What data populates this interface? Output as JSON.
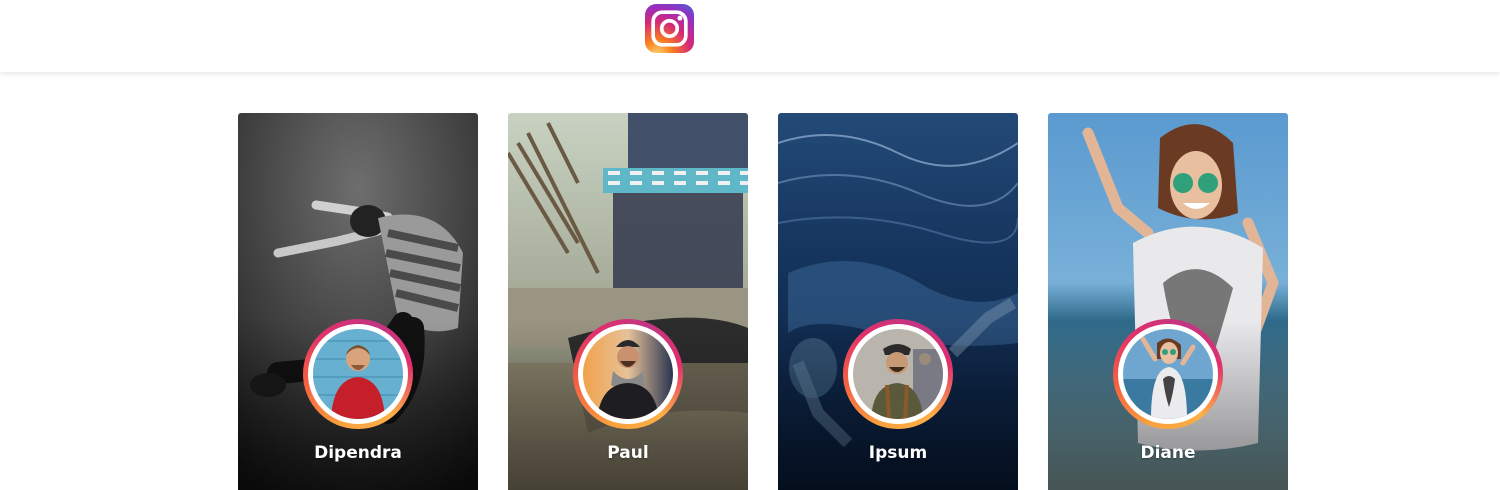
{
  "header": {
    "logo_icon": "instagram-icon",
    "logo_colors": [
      "#feda75",
      "#fa7e1e",
      "#d62976",
      "#962fbf",
      "#4f5bd5"
    ]
  },
  "stories": [
    {
      "name": "Dipendra",
      "avatar_icon": "profile-photo",
      "background": "grayscale-dancer-photo"
    },
    {
      "name": "Paul",
      "avatar_icon": "profile-photo",
      "background": "sunglasses-on-sand-photo"
    },
    {
      "name": "Ipsum",
      "avatar_icon": "profile-photo",
      "background": "underwater-swimmers-photo"
    },
    {
      "name": "Diane",
      "avatar_icon": "profile-photo",
      "background": "jumping-woman-beach-photo"
    }
  ],
  "ring_colors": [
    "#f9a03f",
    "#f56040",
    "#e1306c",
    "#c13584"
  ]
}
